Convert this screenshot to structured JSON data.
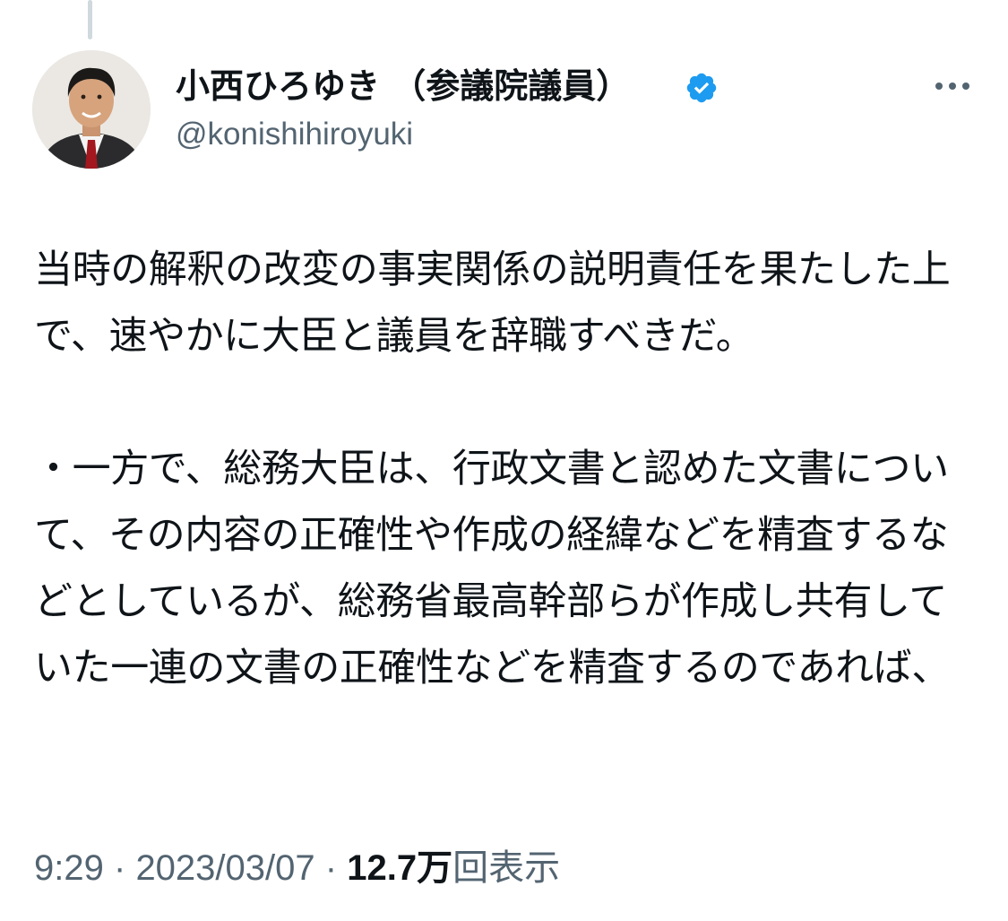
{
  "author": {
    "display_name": "小西ひろゆき （参議院議員）",
    "handle": "@konishihiroyuki",
    "verified": true,
    "avatar": "avatar-photo"
  },
  "tweet": {
    "text": "当時の解釈の改変の事実関係の説明責任を果たした上で、速やかに大臣と議員を辞職すべきだ。\n\n・一方で、総務大臣は、行政文書と認めた文書について、その内容の正確性や作成の経緯などを精査するなどとしているが、総務省最高幹部らが作成し共有していた一連の文書の正確性などを精査するのであれば、"
  },
  "meta": {
    "time": "9:29",
    "separator": "·",
    "date": "2023/03/07",
    "views_count": "12.7万",
    "views_label": "回表示"
  },
  "icons": {
    "more": "more-horizontal-icon",
    "verified": "verified-badge-icon"
  },
  "colors": {
    "verified_blue": "#1d9bf0",
    "secondary_text": "#536471",
    "primary_text": "#0f1419"
  }
}
